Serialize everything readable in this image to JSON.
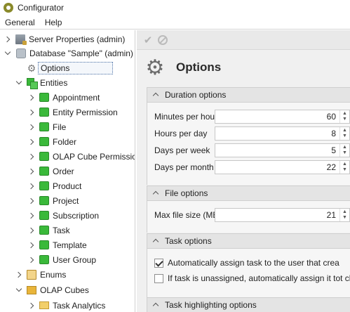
{
  "window": {
    "title": "Configurator"
  },
  "menu": [
    "General",
    "Help"
  ],
  "tree": {
    "server": "Server Properties (admin)",
    "database": "Database \"Sample\" (admin)",
    "options": "Options",
    "entities": "Entities",
    "entity_items": [
      "Appointment",
      "Entity Permission",
      "File",
      "Folder",
      "OLAP Cube Permission",
      "Order",
      "Product",
      "Project",
      "Subscription",
      "Task",
      "Template",
      "User Group"
    ],
    "enums": "Enums",
    "olap_cubes": "OLAP Cubes",
    "task_analytics": "Task Analytics"
  },
  "toolbar": {
    "save_icon": "check-icon",
    "cancel_icon": "cancel-icon"
  },
  "page": {
    "title": "Options",
    "icon": "gear-icon"
  },
  "duration": {
    "title": "Duration options",
    "fields": [
      {
        "label": "Minutes per hour",
        "value": "60"
      },
      {
        "label": "Hours per day",
        "value": "8"
      },
      {
        "label": "Days per week",
        "value": "5"
      },
      {
        "label": "Days per month",
        "value": "22"
      }
    ]
  },
  "file": {
    "title": "File options",
    "fields": [
      {
        "label": "Max file size (MB)",
        "value": "21"
      }
    ]
  },
  "task": {
    "title": "Task options",
    "checks": [
      {
        "label": "Automatically assign task to the user that crea",
        "checked": true
      },
      {
        "label": "If task is unassigned, automatically assign it tot chang",
        "checked": false
      }
    ]
  },
  "highlight": {
    "title": "Task highlighting options"
  }
}
